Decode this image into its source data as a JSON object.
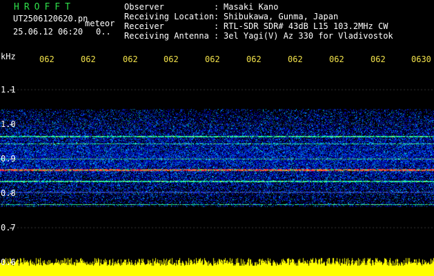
{
  "header": {
    "title": "HROFFT",
    "filename": "UT2506120620.pn",
    "meteor_label": "meteor",
    "timestamp": "25.06.12 06:20",
    "timestamp_extra": "0..",
    "info": [
      {
        "key": "Observer",
        "sep": ":",
        "value": "Masaki Kano"
      },
      {
        "key": "Receiving Location",
        "sep": ":",
        "value": "Shibukawa, Gunma, Japan"
      },
      {
        "key": "Receiver",
        "sep": ":",
        "value": "RTL-SDR SDR# 43dB L15 103.2MHz CW"
      },
      {
        "key": "Receiving Antenna",
        "sep": ":",
        "value": "3el Yagi(V) Az 330 for Vladivostok"
      }
    ]
  },
  "axes": {
    "y_unit": "kHz",
    "y_ticks": [
      "1.1",
      "1.0",
      "0.9",
      "0.8",
      "0.7",
      "0.6"
    ],
    "x_ticks": [
      "062",
      "062",
      "062",
      "062",
      "062",
      "062",
      "062",
      "062",
      "062",
      "0630"
    ]
  },
  "colors": {
    "background": "#000000",
    "header_title": "#2fe04a",
    "time_ticks": "#f2e24a",
    "noise_floor": "#ffff00",
    "text": "#ffffff"
  }
}
